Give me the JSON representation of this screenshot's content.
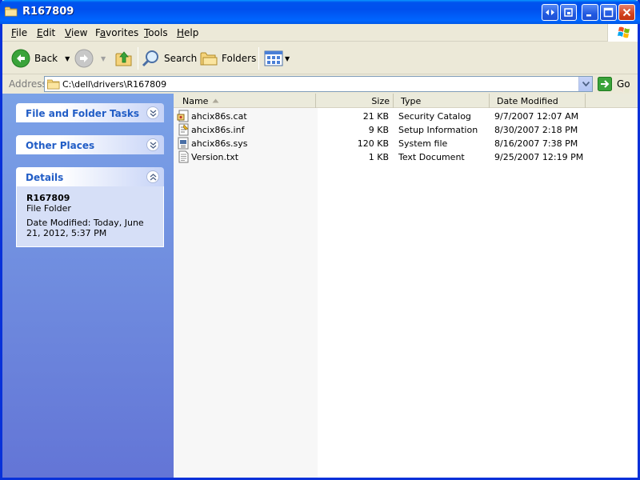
{
  "window": {
    "title": "R167809"
  },
  "menu": [
    {
      "label": "File",
      "u": "F",
      "rest": "ile"
    },
    {
      "label": "Edit",
      "u": "E",
      "rest": "dit"
    },
    {
      "label": "View",
      "u": "V",
      "rest": "iew"
    },
    {
      "label": "Favorites",
      "u": "F",
      "rest": "avorites",
      "pre": "",
      "underline_index": 1
    },
    {
      "label": "Tools",
      "u": "T",
      "rest": "ools"
    },
    {
      "label": "Help",
      "u": "H",
      "rest": "elp"
    }
  ],
  "toolbar": {
    "back_label": "Back",
    "search_label": "Search",
    "folders_label": "Folders"
  },
  "address": {
    "label": "Address",
    "value": "C:\\dell\\drivers\\R167809",
    "go_label": "Go"
  },
  "left_panel": {
    "file_tasks_title": "File and Folder Tasks",
    "other_places_title": "Other Places",
    "details_title": "Details",
    "details": {
      "name": "R167809",
      "type": "File Folder",
      "modified": "Date Modified: Today, June 21, 2012, 5:37 PM"
    }
  },
  "list": {
    "columns": {
      "name": "Name",
      "size": "Size",
      "type": "Type",
      "date": "Date Modified"
    },
    "rows": [
      {
        "name": "ahcix86s.cat",
        "size": "21 KB",
        "type": "Security Catalog",
        "date": "9/7/2007 12:07 AM",
        "icon": "catalog-file-icon"
      },
      {
        "name": "ahcix86s.inf",
        "size": "9 KB",
        "type": "Setup Information",
        "date": "8/30/2007 2:18 PM",
        "icon": "setup-info-file-icon"
      },
      {
        "name": "ahcix86s.sys",
        "size": "120 KB",
        "type": "System file",
        "date": "8/16/2007 7:38 PM",
        "icon": "system-file-icon"
      },
      {
        "name": "Version.txt",
        "size": "1 KB",
        "type": "Text Document",
        "date": "9/25/2007 12:19 PM",
        "icon": "text-file-icon"
      }
    ]
  },
  "colors": {
    "titlebar": "#0054e3",
    "left_panel_top": "#7ba2e7",
    "left_panel_bottom": "#6375d6",
    "task_header_text": "#215dc6",
    "task_body": "#d6dff7"
  }
}
